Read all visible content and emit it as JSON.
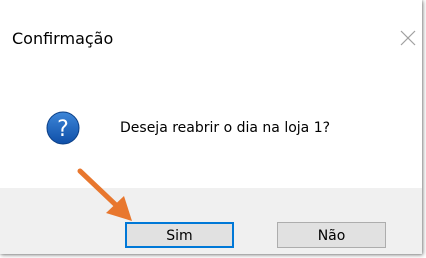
{
  "dialog": {
    "title": "Confirmação",
    "message": "Deseja reabrir o dia na loja 1?",
    "icon": "question-icon",
    "close_icon": "close-icon"
  },
  "buttons": {
    "yes_label": "Sim",
    "no_label": "Não"
  },
  "annotation": {
    "icon": "arrow-icon",
    "color": "#e8772e"
  },
  "colors": {
    "accent": "#0078d7",
    "icon_blue": "#1a5fb4",
    "footer_bg": "#f0f0f0",
    "button_bg": "#e1e1e1"
  }
}
